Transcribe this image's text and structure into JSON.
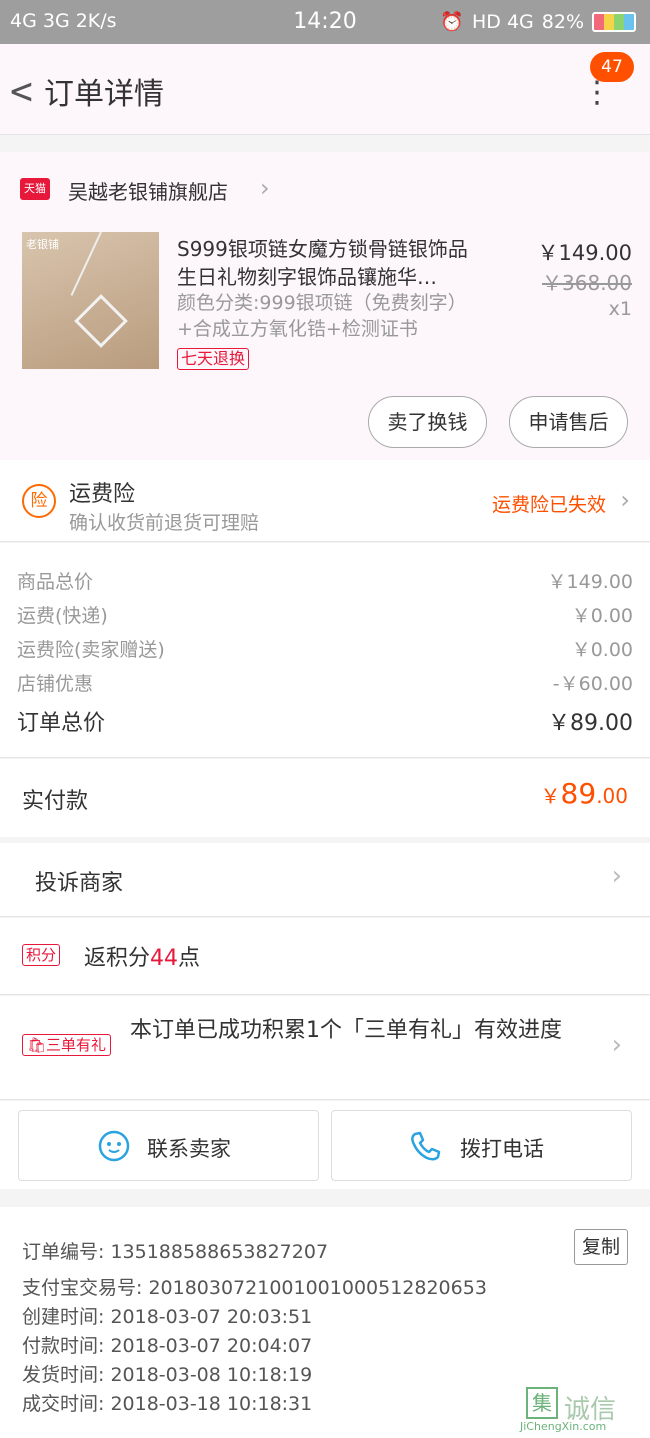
{
  "status_bar": {
    "left": "4G  3G  2K/s",
    "time": "14:20",
    "hd": "HD 4G",
    "battery": "82%"
  },
  "header": {
    "back_icon": "chevron-left-icon",
    "title": "订单详情",
    "more_icon": "more-vertical-icon",
    "badge": "47"
  },
  "shop": {
    "logo_text": "天猫",
    "name": "吴越老银铺旗舰店",
    "product": {
      "image_brand": "老银铺",
      "name": "S999银项链女魔方锁骨链银饰品生日礼物刻字银饰品镶施华…",
      "spec": "颜色分类:999银项链（免费刻字）+合成立方氧化锆+检测证书",
      "tag": "七天退换",
      "price": "￥149.00",
      "original_price": "￥368.00",
      "quantity": "x1"
    },
    "buttons": {
      "sell": "卖了换钱",
      "aftersale": "申请售后"
    }
  },
  "insurance": {
    "icon_text": "险",
    "title": "运费险",
    "subtitle": "确认收货前退货可理赔",
    "status": "运费险已失效"
  },
  "summary": {
    "rows": [
      {
        "label": "商品总价",
        "value": "￥149.00"
      },
      {
        "label": "运费(快递)",
        "value": "￥0.00"
      },
      {
        "label": "运费险(卖家赠送)",
        "value": "￥0.00"
      },
      {
        "label": "店铺优惠",
        "value": "-￥60.00"
      }
    ],
    "total_label": "订单总价",
    "total_value": "￥89.00"
  },
  "paid": {
    "label": "实付款",
    "currency": "￥",
    "amount_int": "89",
    "amount_dec": ".00"
  },
  "complain": {
    "label": "投诉商家"
  },
  "points": {
    "tag": "积分",
    "prefix": "返积分",
    "number": "44",
    "suffix": "点"
  },
  "gift": {
    "tag": "三单有礼",
    "text": "本订单已成功积累1个「三单有礼」有效进度"
  },
  "contact": {
    "seller_label": "联系卖家",
    "phone_label": "拨打电话",
    "colors": {
      "icon": "#2aa3e0"
    }
  },
  "order_info": {
    "copy_label": "复制",
    "rows": [
      "订单编号: 1351885886538272​07",
      "支付宝交易号: 2018030721001001000512820653",
      "创建时间: 2018-03-07 20:03:51",
      "付款时间: 2018-03-07 20:04:07",
      "发货时间: 2018-03-08 10:18:19",
      "成交时间: 2018-03-18 10:18:31"
    ]
  },
  "watermark": {
    "char1": "集",
    "chars": "诚信",
    "url": "JiChengXin.com"
  },
  "colors": {
    "accent": "#ff5000",
    "tmall_red": "#e8183b",
    "status_bar": "#9e9e9e"
  }
}
